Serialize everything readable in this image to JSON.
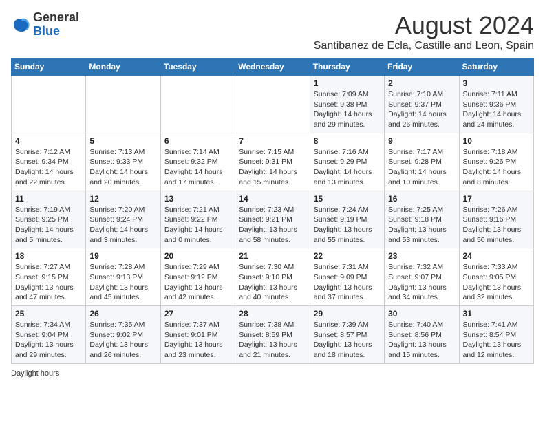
{
  "header": {
    "logo_general": "General",
    "logo_blue": "Blue",
    "month_title": "August 2024",
    "location": "Santibanez de Ecla, Castille and Leon, Spain"
  },
  "days_of_week": [
    "Sunday",
    "Monday",
    "Tuesday",
    "Wednesday",
    "Thursday",
    "Friday",
    "Saturday"
  ],
  "weeks": [
    [
      {
        "day": "",
        "info": ""
      },
      {
        "day": "",
        "info": ""
      },
      {
        "day": "",
        "info": ""
      },
      {
        "day": "",
        "info": ""
      },
      {
        "day": "1",
        "info": "Sunrise: 7:09 AM\nSunset: 9:38 PM\nDaylight: 14 hours and 29 minutes."
      },
      {
        "day": "2",
        "info": "Sunrise: 7:10 AM\nSunset: 9:37 PM\nDaylight: 14 hours and 26 minutes."
      },
      {
        "day": "3",
        "info": "Sunrise: 7:11 AM\nSunset: 9:36 PM\nDaylight: 14 hours and 24 minutes."
      }
    ],
    [
      {
        "day": "4",
        "info": "Sunrise: 7:12 AM\nSunset: 9:34 PM\nDaylight: 14 hours and 22 minutes."
      },
      {
        "day": "5",
        "info": "Sunrise: 7:13 AM\nSunset: 9:33 PM\nDaylight: 14 hours and 20 minutes."
      },
      {
        "day": "6",
        "info": "Sunrise: 7:14 AM\nSunset: 9:32 PM\nDaylight: 14 hours and 17 minutes."
      },
      {
        "day": "7",
        "info": "Sunrise: 7:15 AM\nSunset: 9:31 PM\nDaylight: 14 hours and 15 minutes."
      },
      {
        "day": "8",
        "info": "Sunrise: 7:16 AM\nSunset: 9:29 PM\nDaylight: 14 hours and 13 minutes."
      },
      {
        "day": "9",
        "info": "Sunrise: 7:17 AM\nSunset: 9:28 PM\nDaylight: 14 hours and 10 minutes."
      },
      {
        "day": "10",
        "info": "Sunrise: 7:18 AM\nSunset: 9:26 PM\nDaylight: 14 hours and 8 minutes."
      }
    ],
    [
      {
        "day": "11",
        "info": "Sunrise: 7:19 AM\nSunset: 9:25 PM\nDaylight: 14 hours and 5 minutes."
      },
      {
        "day": "12",
        "info": "Sunrise: 7:20 AM\nSunset: 9:24 PM\nDaylight: 14 hours and 3 minutes."
      },
      {
        "day": "13",
        "info": "Sunrise: 7:21 AM\nSunset: 9:22 PM\nDaylight: 14 hours and 0 minutes."
      },
      {
        "day": "14",
        "info": "Sunrise: 7:23 AM\nSunset: 9:21 PM\nDaylight: 13 hours and 58 minutes."
      },
      {
        "day": "15",
        "info": "Sunrise: 7:24 AM\nSunset: 9:19 PM\nDaylight: 13 hours and 55 minutes."
      },
      {
        "day": "16",
        "info": "Sunrise: 7:25 AM\nSunset: 9:18 PM\nDaylight: 13 hours and 53 minutes."
      },
      {
        "day": "17",
        "info": "Sunrise: 7:26 AM\nSunset: 9:16 PM\nDaylight: 13 hours and 50 minutes."
      }
    ],
    [
      {
        "day": "18",
        "info": "Sunrise: 7:27 AM\nSunset: 9:15 PM\nDaylight: 13 hours and 47 minutes."
      },
      {
        "day": "19",
        "info": "Sunrise: 7:28 AM\nSunset: 9:13 PM\nDaylight: 13 hours and 45 minutes."
      },
      {
        "day": "20",
        "info": "Sunrise: 7:29 AM\nSunset: 9:12 PM\nDaylight: 13 hours and 42 minutes."
      },
      {
        "day": "21",
        "info": "Sunrise: 7:30 AM\nSunset: 9:10 PM\nDaylight: 13 hours and 40 minutes."
      },
      {
        "day": "22",
        "info": "Sunrise: 7:31 AM\nSunset: 9:09 PM\nDaylight: 13 hours and 37 minutes."
      },
      {
        "day": "23",
        "info": "Sunrise: 7:32 AM\nSunset: 9:07 PM\nDaylight: 13 hours and 34 minutes."
      },
      {
        "day": "24",
        "info": "Sunrise: 7:33 AM\nSunset: 9:05 PM\nDaylight: 13 hours and 32 minutes."
      }
    ],
    [
      {
        "day": "25",
        "info": "Sunrise: 7:34 AM\nSunset: 9:04 PM\nDaylight: 13 hours and 29 minutes."
      },
      {
        "day": "26",
        "info": "Sunrise: 7:35 AM\nSunset: 9:02 PM\nDaylight: 13 hours and 26 minutes."
      },
      {
        "day": "27",
        "info": "Sunrise: 7:37 AM\nSunset: 9:01 PM\nDaylight: 13 hours and 23 minutes."
      },
      {
        "day": "28",
        "info": "Sunrise: 7:38 AM\nSunset: 8:59 PM\nDaylight: 13 hours and 21 minutes."
      },
      {
        "day": "29",
        "info": "Sunrise: 7:39 AM\nSunset: 8:57 PM\nDaylight: 13 hours and 18 minutes."
      },
      {
        "day": "30",
        "info": "Sunrise: 7:40 AM\nSunset: 8:56 PM\nDaylight: 13 hours and 15 minutes."
      },
      {
        "day": "31",
        "info": "Sunrise: 7:41 AM\nSunset: 8:54 PM\nDaylight: 13 hours and 12 minutes."
      }
    ]
  ],
  "footer": {
    "daylight_hours": "Daylight hours"
  }
}
